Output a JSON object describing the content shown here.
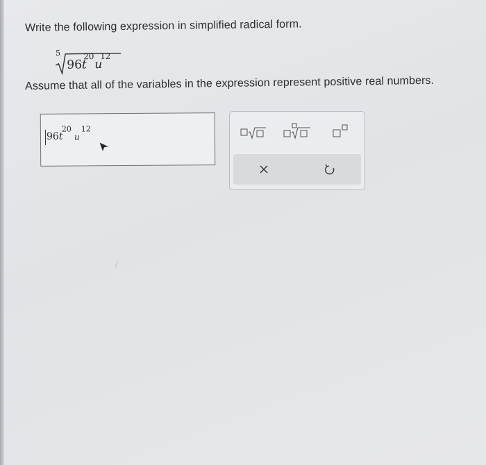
{
  "question": {
    "prompt": "Write the following expression in simplified radical form.",
    "expression": {
      "index": "5",
      "coefficient": "96",
      "var1": "t",
      "exp1": "20",
      "var2": "u",
      "exp2": "12"
    },
    "assumption": "Assume that all of the variables in the expression represent positive real numbers."
  },
  "answer": {
    "coefficient": "96",
    "var1": "t",
    "exp1": "20",
    "var2": "u",
    "exp2": "12"
  },
  "toolbar": {
    "tools": [
      "square-root-template-icon",
      "nth-root-template-icon",
      "superscript-template-icon"
    ],
    "actions": [
      "clear-x-icon",
      "undo-icon"
    ]
  },
  "colors": {
    "background": "#e4e6e9",
    "text": "#2b2b2b",
    "input_border": "#6e7075",
    "toolbar_border": "#b9bbc0",
    "action_bar": "#d9dadd"
  }
}
